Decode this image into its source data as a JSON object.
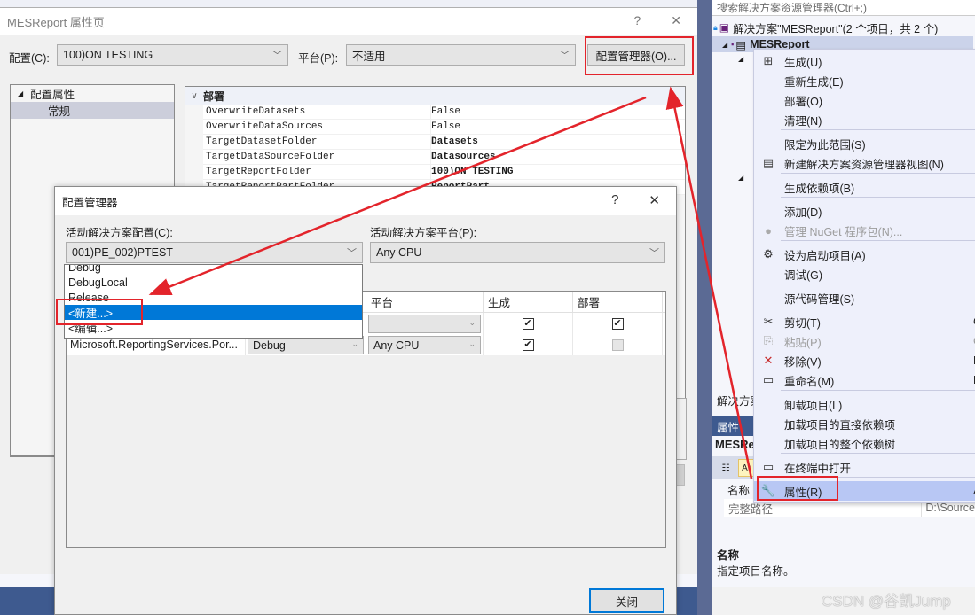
{
  "property_page": {
    "title": "MESReport 属性页",
    "help": "?",
    "close": "✕",
    "config_label": "配置(C):",
    "config_value": "100)ON TESTING",
    "platform_label": "平台(P):",
    "platform_value": "不适用",
    "config_manager_button": "配置管理器(O)...",
    "tree": [
      {
        "label": "配置属性",
        "expanded": true
      },
      {
        "label": "常规",
        "selected": true
      }
    ],
    "grid": {
      "category": "部署",
      "rows": [
        {
          "key": "OverwriteDatasets",
          "value": "False",
          "bold": false
        },
        {
          "key": "OverwriteDataSources",
          "value": "False",
          "bold": false
        },
        {
          "key": "TargetDatasetFolder",
          "value": "Datasets",
          "bold": true
        },
        {
          "key": "TargetDataSourceFolder",
          "value": "Datasources",
          "bold": true
        },
        {
          "key": "TargetReportFolder",
          "value": "100)ON TESTING",
          "bold": true
        },
        {
          "key": "TargetReportPartFolder",
          "value": "ReportPart",
          "bold": true
        }
      ]
    }
  },
  "config_manager": {
    "title": "配置管理器",
    "help": "?",
    "close": "✕",
    "active_config_label": "活动解决方案配置(C):",
    "active_config_value": "001)PE_002)PTEST",
    "active_platform_label": "活动解决方案平台(P):",
    "active_platform_value": "Any CPU",
    "dropdown_options": [
      {
        "label": "Debug",
        "selected": false
      },
      {
        "label": "DebugLocal",
        "selected": false
      },
      {
        "label": "Release",
        "selected": false
      },
      {
        "label": "<新建...>",
        "selected": true
      },
      {
        "label": "<编辑...>",
        "selected": false
      }
    ],
    "columns": {
      "platform": "平台",
      "build": "生成",
      "deploy": "部署"
    },
    "rows": [
      {
        "project": "",
        "config": "",
        "platform": "",
        "build": true,
        "deploy": true
      },
      {
        "project": "Microsoft.ReportingServices.Por...",
        "config": "Debug",
        "platform": "Any CPU",
        "build": true,
        "deploy": false
      }
    ],
    "close_button": "关闭"
  },
  "solution_explorer": {
    "search_placeholder": "搜索解决方案资源管理器(Ctrl+;)",
    "solution_node": "解决方案\"MESReport\"(2 个项目，共 2 个)",
    "project_node": "MESReport",
    "hint_text": "解决方案"
  },
  "properties_panel": {
    "title": "属性",
    "object": "MESRe",
    "name_header": "名称",
    "rows": [
      {
        "key": "完整路径",
        "value": "D:\\Source"
      }
    ],
    "desc_title": "名称",
    "desc_text": "指定项目名称。"
  },
  "context_menu": {
    "items": [
      {
        "label": "生成(U)",
        "icon": "build-icon",
        "glyph": "⊞",
        "shortcut": "",
        "disabled": false
      },
      {
        "label": "重新生成(E)",
        "icon": "",
        "glyph": "",
        "shortcut": "",
        "disabled": false
      },
      {
        "label": "部署(O)",
        "icon": "",
        "glyph": "",
        "shortcut": "",
        "disabled": false
      },
      {
        "label": "清理(N)",
        "icon": "",
        "glyph": "",
        "shortcut": "",
        "disabled": false
      },
      {
        "label": "限定为此范围(S)",
        "icon": "",
        "glyph": "",
        "shortcut": "",
        "disabled": false
      },
      {
        "label": "新建解决方案资源管理器视图(N)",
        "icon": "new-view-icon",
        "glyph": "▤",
        "shortcut": "",
        "disabled": false
      },
      {
        "label": "生成依赖项(B)",
        "icon": "",
        "glyph": "",
        "shortcut": "",
        "disabled": false
      },
      {
        "label": "添加(D)",
        "icon": "",
        "glyph": "",
        "shortcut": "",
        "disabled": false
      },
      {
        "label": "管理 NuGet 程序包(N)...",
        "icon": "nuget-icon",
        "glyph": "●",
        "shortcut": "",
        "disabled": true
      },
      {
        "label": "设为启动项目(A)",
        "icon": "gear-icon",
        "glyph": "⚙",
        "shortcut": "",
        "disabled": false
      },
      {
        "label": "调试(G)",
        "icon": "",
        "glyph": "",
        "shortcut": "",
        "disabled": false
      },
      {
        "label": "源代码管理(S)",
        "icon": "",
        "glyph": "",
        "shortcut": "",
        "disabled": false
      },
      {
        "label": "剪切(T)",
        "icon": "scissors-icon",
        "glyph": "✂",
        "shortcut": "C",
        "disabled": false
      },
      {
        "label": "粘贴(P)",
        "icon": "paste-icon",
        "glyph": "⎘",
        "shortcut": "C",
        "disabled": true
      },
      {
        "label": "移除(V)",
        "icon": "remove-icon",
        "glyph": "✕",
        "shortcut": "D",
        "disabled": false
      },
      {
        "label": "重命名(M)",
        "icon": "rename-icon",
        "glyph": "▭",
        "shortcut": "F",
        "disabled": false
      },
      {
        "label": "卸载项目(L)",
        "icon": "",
        "glyph": "",
        "shortcut": "",
        "disabled": false
      },
      {
        "label": "加载项目的直接依赖项",
        "icon": "",
        "glyph": "",
        "shortcut": "",
        "disabled": false
      },
      {
        "label": "加载项目的整个依赖树",
        "icon": "",
        "glyph": "",
        "shortcut": "",
        "disabled": false
      },
      {
        "label": "在终端中打开",
        "icon": "terminal-icon",
        "glyph": "▭",
        "shortcut": "",
        "disabled": false
      },
      {
        "label": "属性(R)",
        "icon": "wrench-icon",
        "glyph": "🔧",
        "shortcut": "A",
        "disabled": false,
        "highlighted": true
      }
    ]
  },
  "watermark": "CSDN @谷凯Jump"
}
